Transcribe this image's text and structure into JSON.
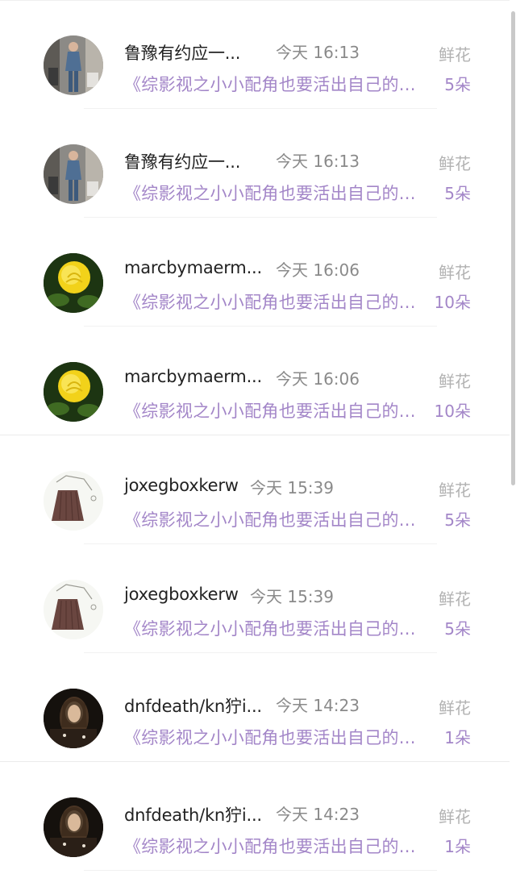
{
  "colors": {
    "name": "#222222",
    "time": "#8a8a8a",
    "gift_label": "#b2b2b2",
    "accent_purple": "#a386c8"
  },
  "rows": [
    {
      "avatar_icon": "person-photo-icon",
      "name": "鲁豫有约应一...",
      "time": "今天 16:13",
      "gift": "鲜花",
      "book": "《综影视之小小配角也要活出自己的...",
      "count": "5朵"
    },
    {
      "avatar_icon": "person-photo-icon",
      "name": "鲁豫有约应一...",
      "time": "今天 16:13",
      "gift": "鲜花",
      "book": "《综影视之小小配角也要活出自己的...",
      "count": "5朵"
    },
    {
      "avatar_icon": "yellow-rose-icon",
      "name": "marcbymaerm...",
      "time": "今天 16:06",
      "gift": "鲜花",
      "book": "《综影视之小小配角也要活出自己的...",
      "count": "10朵"
    },
    {
      "avatar_icon": "yellow-rose-icon",
      "name": "marcbymaerm...",
      "time": "今天 16:06",
      "gift": "鲜花",
      "book": "《综影视之小小配角也要活出自己的...",
      "count": "10朵"
    },
    {
      "avatar_icon": "skirt-sketch-icon",
      "name": "joxegboxkerw",
      "time": "今天 15:39",
      "gift": "鲜花",
      "book": "《综影视之小小配角也要活出自己的...",
      "count": "5朵"
    },
    {
      "avatar_icon": "skirt-sketch-icon",
      "name": "joxegboxkerw",
      "time": "今天 15:39",
      "gift": "鲜花",
      "book": "《综影视之小小配角也要活出自己的...",
      "count": "5朵"
    },
    {
      "avatar_icon": "dark-portrait-icon",
      "name": "dnfdeath/kn狞i...",
      "time": "今天 14:23",
      "gift": "鲜花",
      "book": "《综影视之小小配角也要活出自己的...",
      "count": "1朵"
    },
    {
      "avatar_icon": "dark-portrait-icon",
      "name": "dnfdeath/kn狞i...",
      "time": "今天 14:23",
      "gift": "鲜花",
      "book": "《综影视之小小配角也要活出自己的...",
      "count": "1朵"
    }
  ]
}
